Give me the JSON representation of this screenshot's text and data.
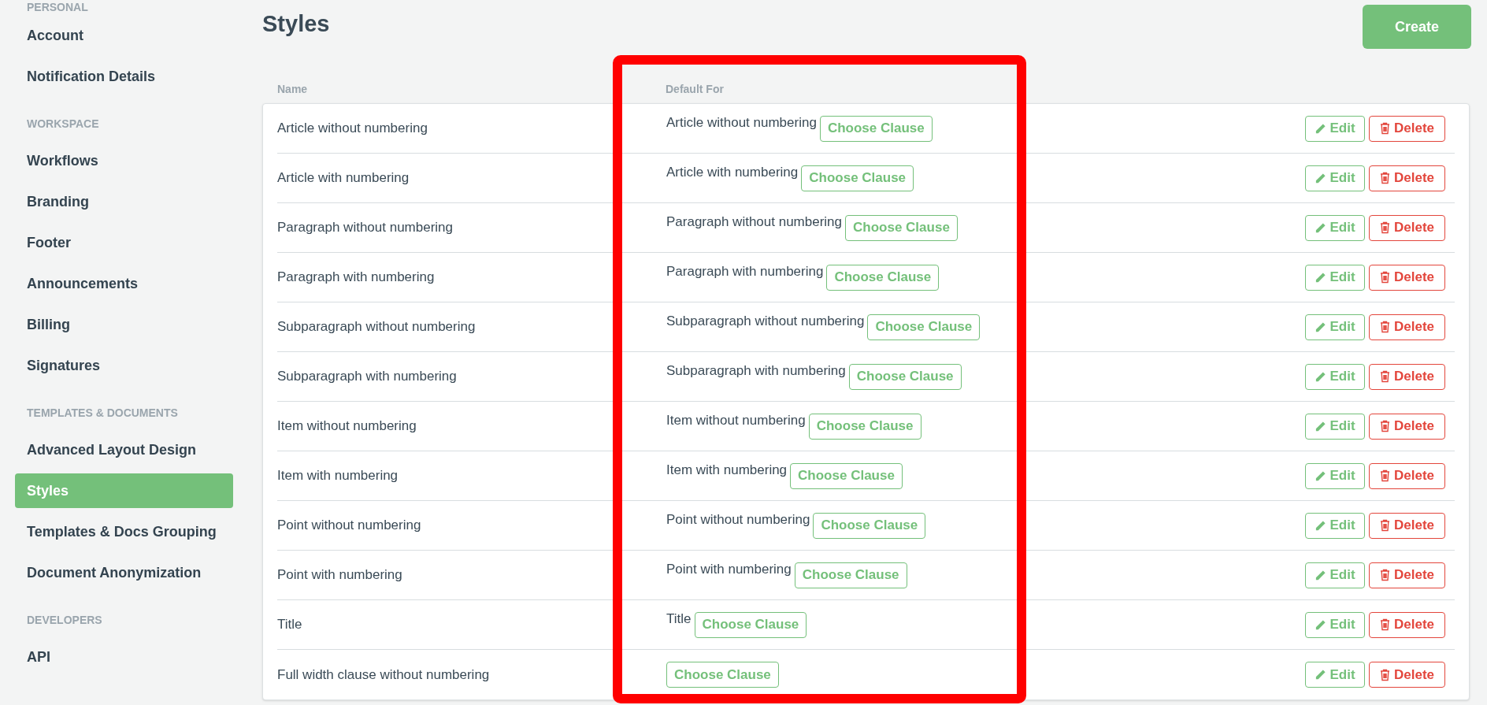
{
  "sidebar": {
    "sections": [
      {
        "heading": "PERSONAL",
        "items": [
          {
            "label": "Account",
            "selected": false
          },
          {
            "label": "Notification Details",
            "selected": false
          }
        ]
      },
      {
        "heading": "WORKSPACE",
        "items": [
          {
            "label": "Workflows",
            "selected": false
          },
          {
            "label": "Branding",
            "selected": false
          },
          {
            "label": "Footer",
            "selected": false
          },
          {
            "label": "Announcements",
            "selected": false
          },
          {
            "label": "Billing",
            "selected": false
          },
          {
            "label": "Signatures",
            "selected": false
          }
        ]
      },
      {
        "heading": "TEMPLATES & DOCUMENTS",
        "items": [
          {
            "label": "Advanced Layout Design",
            "selected": false
          },
          {
            "label": "Styles",
            "selected": true
          },
          {
            "label": "Templates & Docs Grouping",
            "selected": false
          },
          {
            "label": "Document Anonymization",
            "selected": false
          }
        ]
      },
      {
        "heading": "DEVELOPERS",
        "items": [
          {
            "label": "API",
            "selected": false
          }
        ]
      }
    ]
  },
  "page": {
    "title": "Styles",
    "create_button": "Create"
  },
  "table": {
    "columns": [
      "Name",
      "Default For"
    ],
    "rows": [
      {
        "name": "Article without numbering",
        "default_for": "Article without numbering",
        "choose": "Choose Clause",
        "edit": "Edit",
        "delete": "Delete"
      },
      {
        "name": "Article with numbering",
        "default_for": "Article with numbering",
        "choose": "Choose Clause",
        "edit": "Edit",
        "delete": "Delete"
      },
      {
        "name": "Paragraph without numbering",
        "default_for": "Paragraph without numbering",
        "choose": "Choose Clause",
        "edit": "Edit",
        "delete": "Delete"
      },
      {
        "name": "Paragraph with numbering",
        "default_for": "Paragraph with numbering",
        "choose": "Choose Clause",
        "edit": "Edit",
        "delete": "Delete"
      },
      {
        "name": "Subparagraph without numbering",
        "default_for": "Subparagraph without numbering",
        "choose": "Choose Clause",
        "edit": "Edit",
        "delete": "Delete"
      },
      {
        "name": "Subparagraph with numbering",
        "default_for": "Subparagraph with numbering",
        "choose": "Choose Clause",
        "edit": "Edit",
        "delete": "Delete"
      },
      {
        "name": "Item without numbering",
        "default_for": "Item without numbering",
        "choose": "Choose Clause",
        "edit": "Edit",
        "delete": "Delete"
      },
      {
        "name": "Item with numbering",
        "default_for": "Item with numbering",
        "choose": "Choose Clause",
        "edit": "Edit",
        "delete": "Delete"
      },
      {
        "name": "Point without numbering",
        "default_for": "Point without numbering",
        "choose": "Choose Clause",
        "edit": "Edit",
        "delete": "Delete"
      },
      {
        "name": "Point with numbering",
        "default_for": "Point with numbering",
        "choose": "Choose Clause",
        "edit": "Edit",
        "delete": "Delete"
      },
      {
        "name": "Title",
        "default_for": "Title",
        "choose": "Choose Clause",
        "edit": "Edit",
        "delete": "Delete"
      },
      {
        "name": "Full width clause without numbering",
        "choose": "Choose Clause",
        "edit": "Edit",
        "delete": "Delete"
      }
    ]
  }
}
